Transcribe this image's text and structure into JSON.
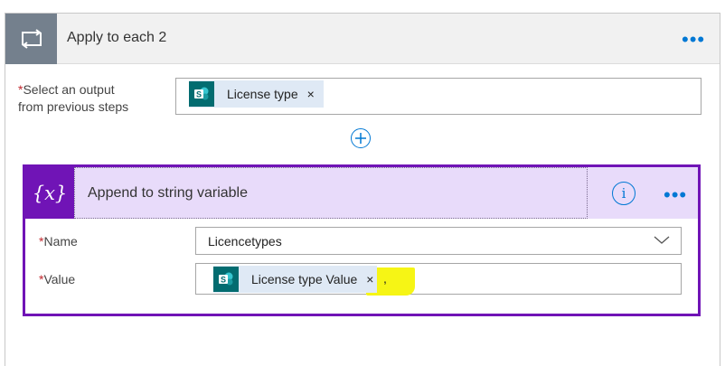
{
  "loop": {
    "title": "Apply to each 2",
    "more_label": "•••",
    "output_field": {
      "required_mark": "*",
      "label_line1": "Select an output",
      "label_line2": "from previous steps",
      "token_text": "License type",
      "token_close": "×"
    },
    "add_step": "+"
  },
  "action": {
    "title": "Append to string variable",
    "info_label": "i",
    "more_label": "•••",
    "name_field": {
      "required_mark": "*",
      "label": "Name",
      "value": "Licencetypes"
    },
    "value_field": {
      "required_mark": "*",
      "label": "Value",
      "token_text": "License type Value",
      "token_close": "×",
      "typed_text": ","
    }
  },
  "colors": {
    "loop_icon_bg": "#74808d",
    "variable_accent": "#7014b6",
    "variable_header_bg": "#e8dbfa",
    "link_blue": "#0078d4",
    "sharepoint": "#036c70",
    "highlight": "#f6f515"
  },
  "icons": {
    "loop": "loop-arrows-icon",
    "variable": "curly-x-variable-icon",
    "sharepoint": "sharepoint-icon",
    "chevron": "chevron-down-icon",
    "info": "info-icon",
    "add": "plus-circle-icon"
  }
}
